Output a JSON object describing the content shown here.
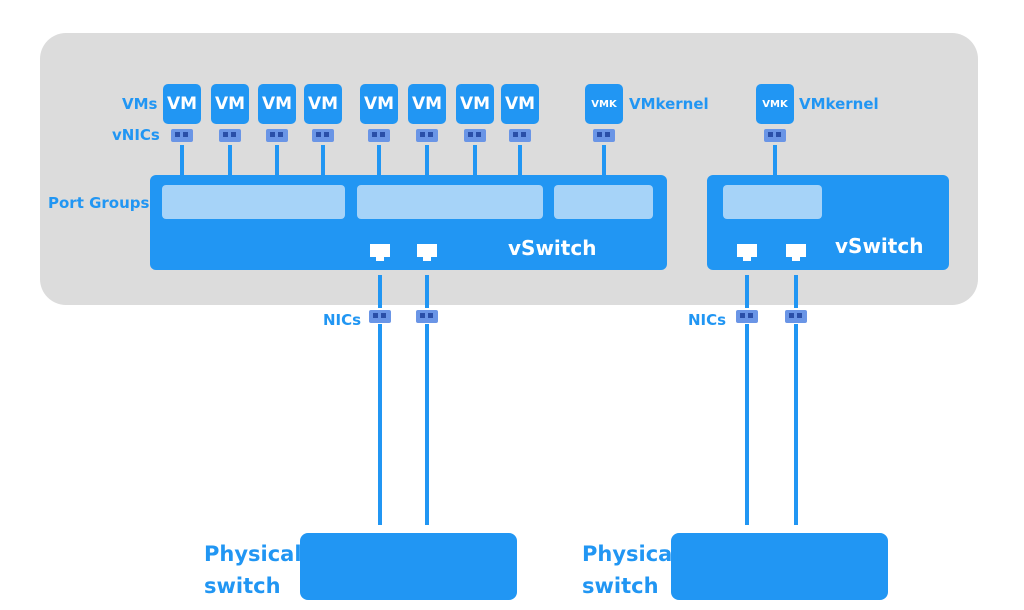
{
  "labels": {
    "vms": "VMs",
    "vnics": "vNICs",
    "port_groups": "Port Groups",
    "nics_1": "NICs",
    "nics_2": "NICs",
    "vmkernel_1": "VMkernel",
    "vmkernel_2": "VMkernel",
    "vswitch_1": "vSwitch",
    "vswitch_2": "vSwitch",
    "physical_1_line1": "Physical",
    "physical_1_line2": "switch",
    "physical_2_line1": "Physical",
    "physical_2_line2": "switch"
  },
  "vms": [
    "VM",
    "VM",
    "VM",
    "VM",
    "VM",
    "VM",
    "VM",
    "VM"
  ],
  "vmk": [
    "VMK",
    "VMK"
  ],
  "colors": {
    "primary": "#2196f3",
    "host_bg": "#dcdcdc",
    "port_group": "#a6d3f8",
    "nic": "#6a95e6"
  }
}
